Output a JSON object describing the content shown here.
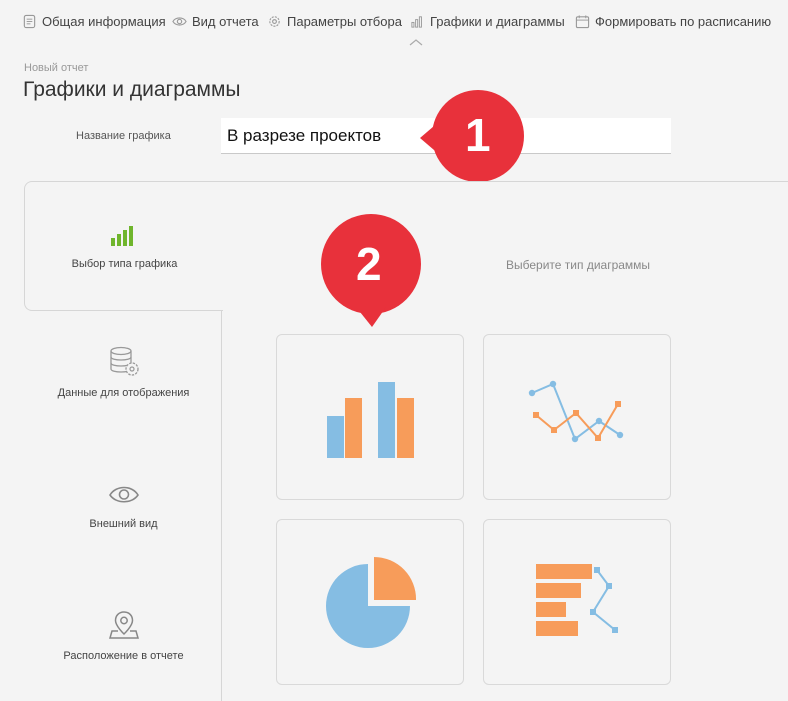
{
  "nav": {
    "items": [
      {
        "label": "Общая информация",
        "icon": "document-icon"
      },
      {
        "label": "Вид отчета",
        "icon": "eye-icon"
      },
      {
        "label": "Параметры отбора",
        "icon": "gear-icon"
      },
      {
        "label": "Графики и диаграммы",
        "icon": "chart-icon",
        "active": true
      },
      {
        "label": "Формировать по расписанию",
        "icon": "calendar-icon"
      }
    ]
  },
  "header": {
    "subtitle": "Новый отчет",
    "title": "Графики и диаграммы"
  },
  "form": {
    "name_label": "Название графика",
    "name_value": "В разрезе проектов"
  },
  "badges": [
    "1",
    "2"
  ],
  "tabs": [
    {
      "label": "Выбор типа графика",
      "icon": "bar-chart-icon",
      "active": true
    },
    {
      "label": "Данные для отображения",
      "icon": "database-gear-icon"
    },
    {
      "label": "Внешний вид",
      "icon": "eye-icon"
    },
    {
      "label": "Расположение в отчете",
      "icon": "map-pin-icon"
    }
  ],
  "panel": {
    "hint": "Выберите тип диаграммы"
  },
  "chart_types": [
    {
      "type": "bar",
      "icon": "bar-chart-icon"
    },
    {
      "type": "line",
      "icon": "line-chart-icon"
    },
    {
      "type": "pie",
      "icon": "pie-chart-icon"
    },
    {
      "type": "horizontal-bar",
      "icon": "horizontal-bar-chart-icon"
    }
  ],
  "colors": {
    "accent_orange": "#f79c5a",
    "accent_blue": "#85bde3",
    "badge_red": "#e8313b",
    "icon_green": "#6fb52c"
  }
}
